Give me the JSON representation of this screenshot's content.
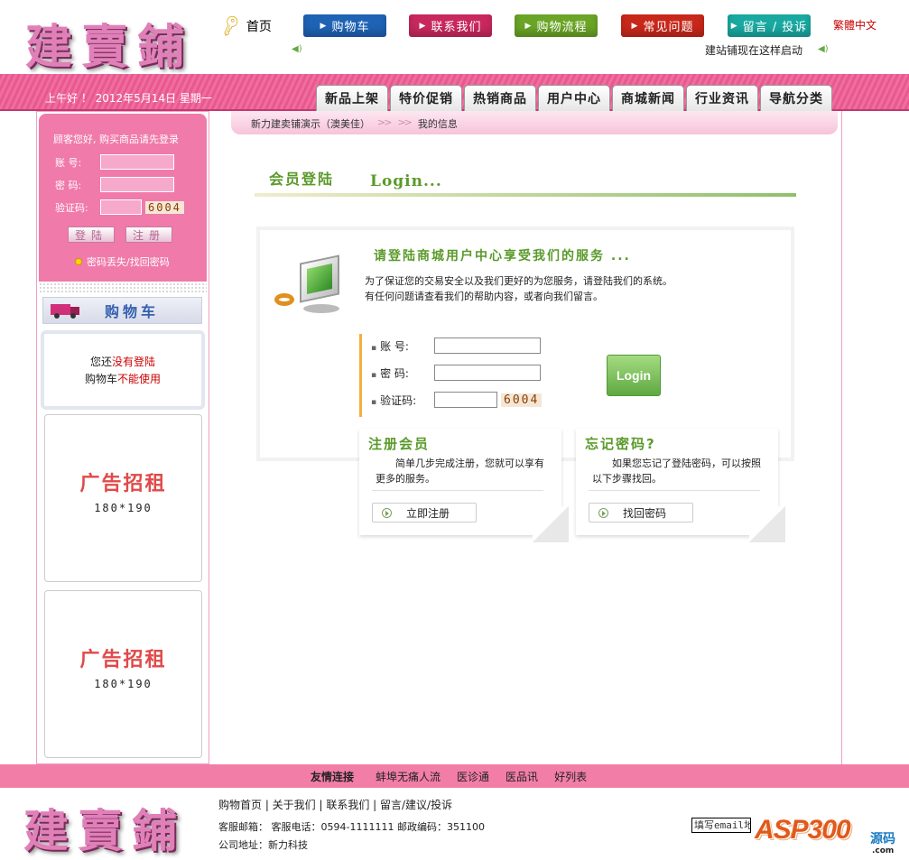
{
  "header": {
    "logo_text": "建賣鋪",
    "home_label": "首页",
    "nav_buttons": [
      {
        "label": "购物车",
        "color": "#1f63b5"
      },
      {
        "label": "联系我们",
        "color": "#c9285f"
      },
      {
        "label": "购物流程",
        "color": "#6aa526"
      },
      {
        "label": "常见问题",
        "color": "#c8281a"
      },
      {
        "label": "留言 / 投诉",
        "color": "#19a9a1"
      }
    ],
    "lang_link": "繁體中文",
    "marquee": "建站铺现在这样启动"
  },
  "navbar": {
    "greeting": "上午好 ！ 2012年5月14日 星期一",
    "tabs": [
      "新品上架",
      "特价促销",
      "热销商品",
      "用户中心",
      "商城新闻",
      "行业资讯",
      "导航分类"
    ]
  },
  "sidebar": {
    "login_hint": "顾客您好, 购买商品请先登录",
    "account_label": "账  号:",
    "password_label": "密  码:",
    "captcha_label": "验证码:",
    "captcha_code": "6004",
    "login_btn": "登陆",
    "register_btn": "注册",
    "forgot": "密码丢失/找回密码",
    "cart_title": "购物车",
    "cart_status_pre": "您还",
    "cart_status_red1": "没有登陆",
    "cart_status_mid": "购物车",
    "cart_status_red2": "不能使用",
    "ads": [
      {
        "title": "广告招租",
        "size": "180*190"
      },
      {
        "title": "广告招租",
        "size": "180*190"
      }
    ]
  },
  "main": {
    "breadcrumb": {
      "site": "新力建卖铺演示（澳美佳）",
      "sep1": ">>",
      "sep2": ">>",
      "current": "我的信息"
    },
    "section_cn": "会员登陆",
    "section_en": "Login...",
    "panel_title": "请登陆商城用户中心享受我们的服务 ...",
    "panel_text1": "为了保证您的交易安全以及我们更好的为您服务，请登陆我们的系统。",
    "panel_text2": "有任何问题请查看我们的帮助内容，或者向我们留言。",
    "form": {
      "account_label": "账  号:",
      "password_label": "密  码:",
      "captcha_label": "验证码:",
      "captcha_code": "6004",
      "login_button": "Login"
    },
    "register_card": {
      "title": "注册会员",
      "text": "简单几步完成注册，您就可以享有更多的服务。",
      "button": "立即注册"
    },
    "forgot_card": {
      "title": "忘记密码?",
      "text": "如果您忘记了登陆密码，可以按照以下步骤找回。",
      "button": "找回密码"
    }
  },
  "footer": {
    "friends_title": "友情连接",
    "friend_links": [
      "蚌埠无痛人流",
      "医诊通",
      "医品讯",
      "好列表"
    ],
    "links": "购物首页  |  关于我们  |  联系我们  |  留言/建议/投诉",
    "contact": "客服邮箱：    客服电话：0594-1111111  邮政编码：351100",
    "address": "公司地址：新力科技",
    "email_placeholder": "填写email地址",
    "brand": "ASP300",
    "brand_src": "源码",
    "brand_com": ".com"
  }
}
